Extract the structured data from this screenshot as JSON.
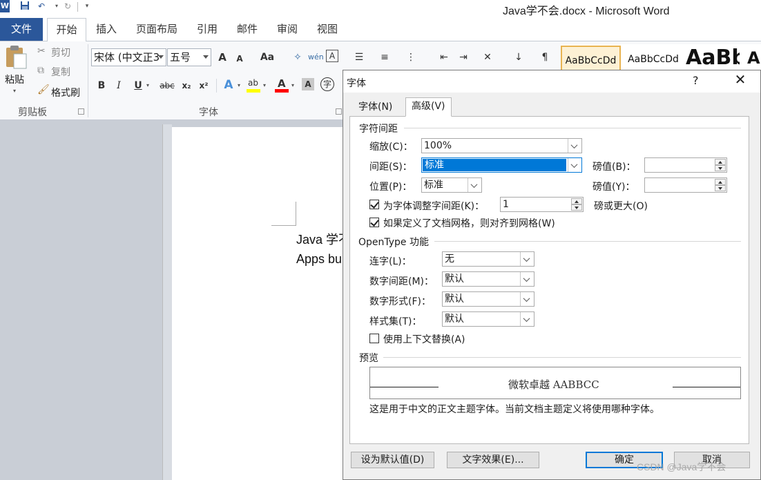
{
  "window": {
    "title": "Java学不会.docx - Microsoft Word",
    "app_icon": "W"
  },
  "ribbon_tabs": [
    "文件",
    "开始",
    "插入",
    "页面布局",
    "引用",
    "邮件",
    "审阅",
    "视图"
  ],
  "clipboard": {
    "paste": "粘贴",
    "cut": "剪切",
    "copy": "复制",
    "format_painter": "格式刷",
    "group_label": "剪贴板"
  },
  "font_group": {
    "font_name": "宋体 (中文正3",
    "font_size": "五号",
    "group_label": "字体",
    "bold": "B",
    "italic": "I",
    "underline": "U",
    "strike": "abc",
    "subscript": "x₂",
    "superscript": "x²",
    "grow": "A",
    "shrink": "A",
    "change_case": "Aa",
    "highlight": "ab",
    "font_color": "A",
    "char_shading": "A",
    "enclose": "字"
  },
  "styles": [
    "AaBbCcDd",
    "AaBbCcDd",
    "AaBb",
    "A"
  ],
  "document": {
    "line1": "Java 学不",
    "line2": "Apps bu"
  },
  "dialog": {
    "title": "字体",
    "help": "?",
    "close": "✕",
    "tabs": [
      "字体(N)",
      "高级(V)"
    ],
    "char_spacing": {
      "section": "字符间距",
      "scale_label": "缩放(C)：",
      "scale_value": "100%",
      "spacing_label": "间距(S)：",
      "spacing_value": "标准",
      "spacing_by_label": "磅值(B)：",
      "spacing_by_value": "",
      "position_label": "位置(P)：",
      "position_value": "标准",
      "position_by_label": "磅值(Y)：",
      "position_by_value": "",
      "kerning_label": "为字体调整字间距(K)：",
      "kerning_value": "1",
      "kerning_suffix": "磅或更大(O)",
      "grid_label": "如果定义了文档网格，则对齐到网格(W)"
    },
    "opentype": {
      "section": "OpenType 功能",
      "ligatures_label": "连字(L)：",
      "ligatures_value": "无",
      "num_spacing_label": "数字间距(M)：",
      "num_spacing_value": "默认",
      "num_forms_label": "数字形式(F)：",
      "num_forms_value": "默认",
      "stylistic_label": "样式集(T)：",
      "stylistic_value": "默认",
      "contextual_label": "使用上下文替换(A)"
    },
    "preview": {
      "section": "预览",
      "sample": "微软卓越  AABBCC",
      "description": "这是用于中文的正文主题字体。当前文档主题定义将使用哪种字体。"
    },
    "buttons": {
      "set_default": "设为默认值(D)",
      "text_effects": "文字效果(E)...",
      "ok": "确定",
      "cancel": "取消"
    }
  },
  "watermark": "CSDN @Java学不会",
  "colors": {
    "word_blue": "#2b579a",
    "selection": "#0078d7",
    "highlight_yellow": "#ffff00",
    "font_red": "#ff0000"
  }
}
